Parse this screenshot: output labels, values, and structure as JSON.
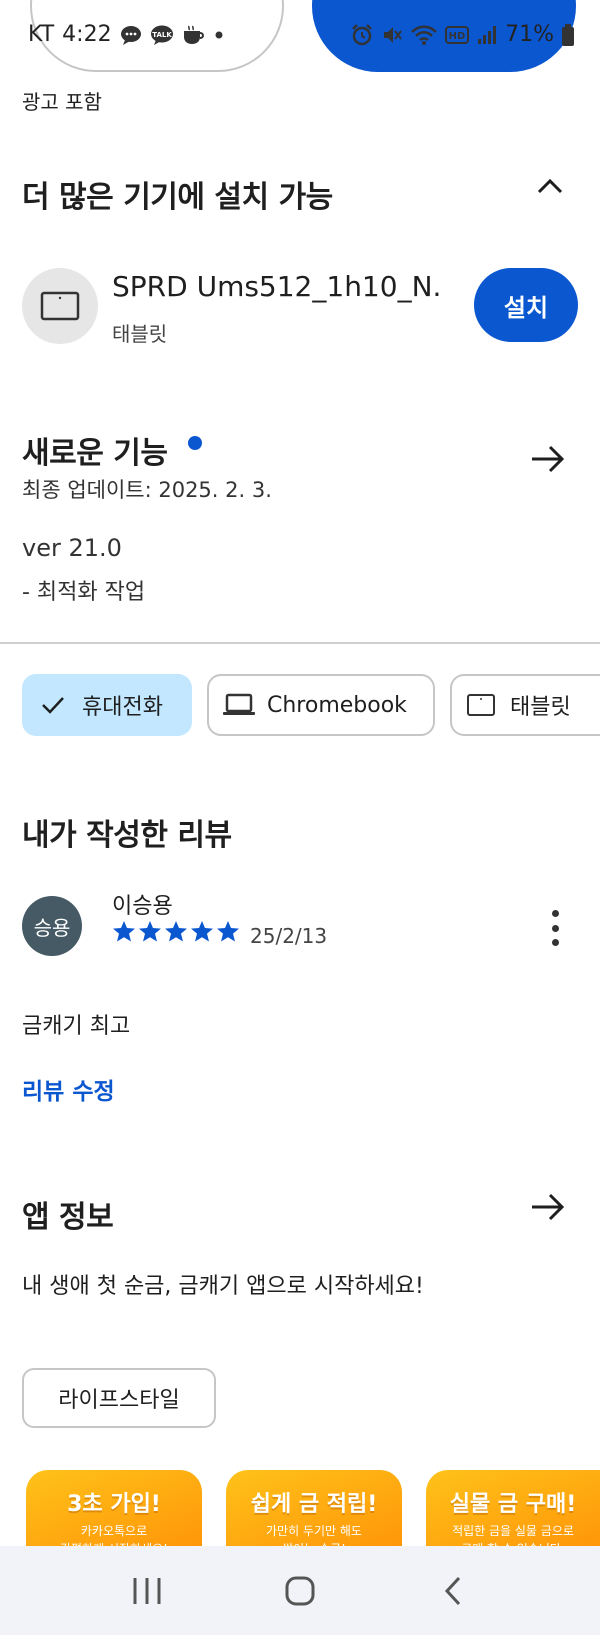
{
  "status_bar": {
    "carrier": "KT",
    "time": "4:22",
    "battery": "71%",
    "left_icons": [
      "chat-bubble-icon",
      "kakaotalk-icon",
      "coffee-icon",
      "dot-icon"
    ],
    "right_icons": [
      "alarm-icon",
      "mute-icon",
      "wifi-icon",
      "hd-icon",
      "signal-icon",
      "battery-icon"
    ],
    "talk_label": "TALK",
    "hd_label": "HD"
  },
  "ad_label": "광고 포함",
  "more_devices": {
    "title": "더 많은 기기에 설치 가능",
    "device_name": "SPRD Ums512_1h10_N...",
    "device_type": "태블릿",
    "install_label": "설치"
  },
  "whats_new": {
    "title": "새로운 기능",
    "last_updated": "최종 업데이트: 2025. 2. 3.",
    "version": "ver 21.0",
    "notes": "- 최적화 작업"
  },
  "device_chips": [
    {
      "label": "휴대전화",
      "selected": true
    },
    {
      "label": "Chromebook",
      "selected": false
    },
    {
      "label": "태블릿",
      "selected": false
    }
  ],
  "my_review": {
    "title": "내가 작성한 리뷰",
    "avatar_text": "승용",
    "reviewer": "이승용",
    "rating": 5,
    "date": "25/2/13",
    "text": "금캐기 최고",
    "edit_label": "리뷰 수정"
  },
  "app_info": {
    "title": "앱 정보",
    "description": "내 생애 첫 순금, 금캐기 앱으로 시작하세요!",
    "category": "라이프스타일"
  },
  "screenshots": [
    {
      "title": "3초 가입!",
      "line1": "카카오톡으로",
      "line2": "간편하게 시작하세요!"
    },
    {
      "title": "쉽게 금 적립!",
      "line1": "가만히 두기만 해도",
      "line2": "쌓이는 순금!"
    },
    {
      "title": "실물 금 구매!",
      "line1": "적립한 금을 실물 금으로",
      "line2": "구매 할 수 있습니다."
    }
  ],
  "colors": {
    "accent": "#0b57d0",
    "chip_selected": "#c2e7ff",
    "avatar_bg": "#455a64",
    "screenshot_orange": "#ff9a0a"
  }
}
